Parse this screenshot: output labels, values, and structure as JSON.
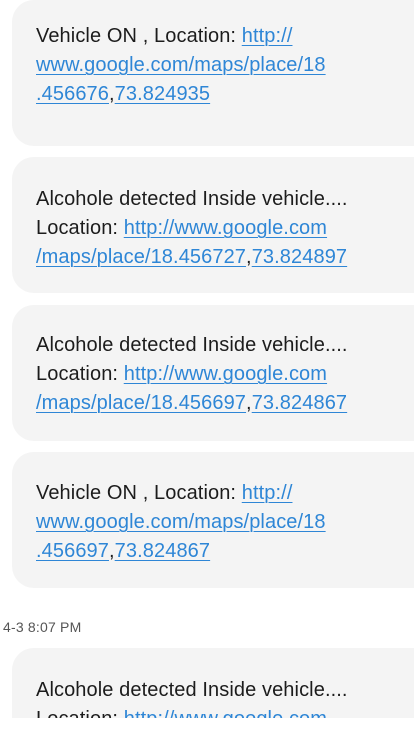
{
  "messages": [
    {
      "lead": "Vehicle ON , Location: ",
      "link_parts": [
        "http://",
        "www.google.com/maps/place/18",
        ".456676",
        "73.824935"
      ]
    },
    {
      "lead": "Alcohole detected Inside vehicle....",
      "label": "Location: ",
      "link_parts": [
        "http://www.google.com",
        "/maps/place/18.456727",
        "73.824897"
      ]
    },
    {
      "lead": "Alcohole detected Inside vehicle....",
      "label": "Location: ",
      "link_parts": [
        "http://www.google.com",
        "/maps/place/18.456697",
        "73.824867"
      ]
    },
    {
      "lead": "Vehicle ON , Location: ",
      "link_parts": [
        "http://",
        "www.google.com/maps/place/18",
        ".456697",
        "73.824867"
      ]
    },
    {
      "lead": "Alcohole detected Inside vehicle....",
      "label": "Location: ",
      "link_parts": [
        "http://www.google.com"
      ]
    }
  ],
  "timestamp": "4-3 8:07 PM",
  "colors": {
    "bubble": "#f4f4f4",
    "link": "#2e86d6",
    "text": "#1c1c1c",
    "timestamp": "#555555"
  }
}
